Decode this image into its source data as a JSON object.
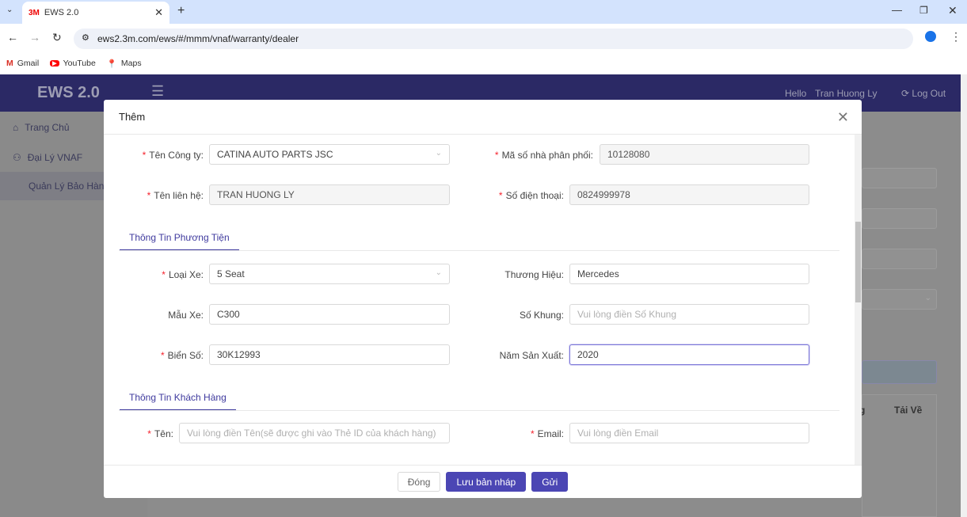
{
  "browser": {
    "tab_title": "EWS 2.0",
    "tab_logo": "3M",
    "url": "ews2.3m.com/ews/#/mmm/vnaf/warranty/dealer",
    "bookmarks": [
      {
        "label": "Gmail",
        "icon": "gmail-icon"
      },
      {
        "label": "YouTube",
        "icon": "youtube-icon"
      },
      {
        "label": "Maps",
        "icon": "maps-icon"
      }
    ]
  },
  "app": {
    "title": "EWS 2.0",
    "hello": "Hello",
    "user": "Tran Huong Ly",
    "logout": "Log Out",
    "accent": "#2b2965"
  },
  "sidebar": {
    "items": [
      {
        "label": "Trang Chủ",
        "icon": "home-icon"
      },
      {
        "label": "Đại Lý VNAF",
        "icon": "user-icon"
      },
      {
        "label": "Quản Lý Bảo Hành"
      }
    ]
  },
  "background": {
    "table_headers": [
      "g",
      "Tải Về"
    ]
  },
  "modal": {
    "title": "Thêm",
    "fields": {
      "company": {
        "label": "Tên Công ty",
        "value": "CATINA AUTO PARTS JSC"
      },
      "distributor_code": {
        "label": "Mã số nhà phân phối",
        "value": "10128080"
      },
      "contact": {
        "label": "Tên liên hệ",
        "value": "TRAN HUONG LY"
      },
      "phone": {
        "label": "Số điện thoại",
        "value": "0824999978"
      },
      "car_type": {
        "label": "Loại Xe",
        "value": "5 Seat"
      },
      "brand": {
        "label": "Thương Hiệu",
        "value": "Mercedes"
      },
      "model": {
        "label": "Mẫu Xe",
        "value": "C300"
      },
      "chassis": {
        "label": "Số Khung",
        "placeholder": "Vui lòng điền Số Khung"
      },
      "plate": {
        "label": "Biển Số",
        "value": "30K12993"
      },
      "year": {
        "label": "Năm Sản Xuất",
        "value": "2020"
      },
      "name": {
        "label": "Tên",
        "placeholder": "Vui lòng điền Tên(sẽ được ghi vào Thẻ ID của khách hàng)"
      },
      "email": {
        "label": "Email",
        "placeholder": "Vui lòng điền Email"
      }
    },
    "sections": {
      "vehicle": "Thông Tin Phương Tiện",
      "customer": "Thông Tin Khách Hàng"
    },
    "buttons": {
      "close": "Đóng",
      "draft": "Lưu bản nháp",
      "submit": "Gửi"
    }
  }
}
